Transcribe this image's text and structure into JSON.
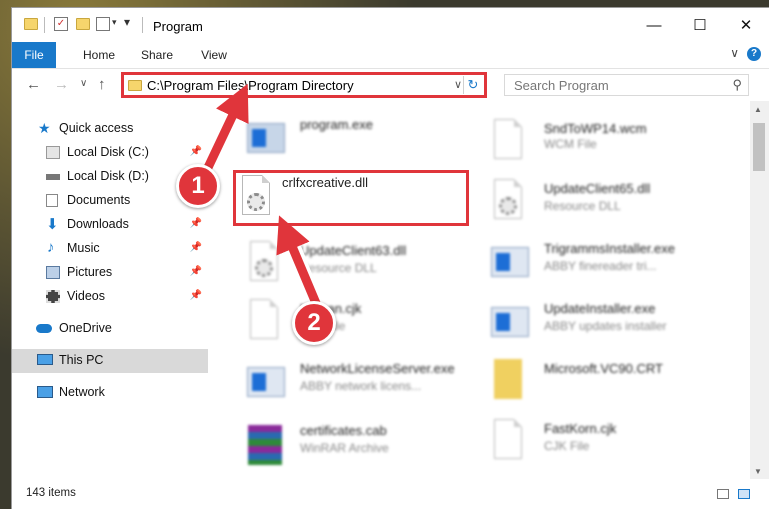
{
  "window": {
    "title": "Program"
  },
  "ribbon": {
    "tabs": [
      "File",
      "Home",
      "Share",
      "View"
    ]
  },
  "address": {
    "path": "C:\\Program Files\\Program Directory"
  },
  "search": {
    "placeholder": "Search Program"
  },
  "nav": {
    "quick_access": "Quick access",
    "items": [
      "Local Disk (C:)",
      "Local Disk (D:)",
      "Documents",
      "Downloads",
      "Music",
      "Pictures",
      "Videos"
    ],
    "onedrive": "OneDrive",
    "this_pc": "This PC",
    "network": "Network"
  },
  "files": {
    "left": [
      {
        "name": "program.exe",
        "type": ""
      },
      {
        "name": "crlfxcreative.dll",
        "type": ""
      },
      {
        "name": "UpdateClient63.dll",
        "type": "Resource DLL"
      },
      {
        "name": "Korean.cjk",
        "type": "CJK File"
      },
      {
        "name": "NetworkLicenseServer.exe",
        "type": "ABBY network licens..."
      },
      {
        "name": "certificates.cab",
        "type": "WinRAR Archive"
      }
    ],
    "right": [
      {
        "name": "SndToWP14.wcm",
        "type": "WCM File"
      },
      {
        "name": "UpdateClient65.dll",
        "type": "Resource DLL"
      },
      {
        "name": "TrigrammsInstaller.exe",
        "type": "ABBY finereader tri..."
      },
      {
        "name": "UpdateInstaller.exe",
        "type": "ABBY updates installer"
      },
      {
        "name": "Microsoft.VC90.CRT",
        "type": ""
      },
      {
        "name": "FastKorn.cjk",
        "type": "CJK File"
      }
    ]
  },
  "status": {
    "items": "143 items"
  },
  "annotations": {
    "step1": "1",
    "step2": "2"
  },
  "colors": {
    "accent": "#1979ca",
    "highlight": "#e0353b"
  }
}
